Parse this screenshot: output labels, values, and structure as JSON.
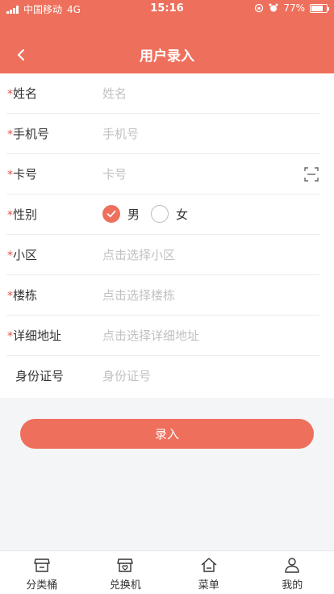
{
  "status_bar": {
    "carrier": "中国移动",
    "network": "4G",
    "time": "15:16",
    "battery": "77%",
    "battery_level": 0.77
  },
  "header": {
    "title": "用户录入",
    "back_icon": "chevron-left-icon"
  },
  "form": {
    "required_mark": "*",
    "name": {
      "label": "姓名",
      "placeholder": "姓名"
    },
    "phone": {
      "label": "手机号",
      "placeholder": "手机号"
    },
    "card": {
      "label": "卡号",
      "placeholder": "卡号",
      "icon": "scan-icon"
    },
    "gender": {
      "label": "性别",
      "options": [
        {
          "label": "男",
          "selected": true
        },
        {
          "label": "女",
          "selected": false
        }
      ]
    },
    "community": {
      "label": "小区",
      "placeholder": "点击选择小区"
    },
    "building": {
      "label": "楼栋",
      "placeholder": "点击选择楼栋"
    },
    "address": {
      "label": "详细地址",
      "placeholder": "点击选择详细地址"
    },
    "id_number": {
      "label": "身份证号",
      "placeholder": "身份证号"
    }
  },
  "submit_label": "录入",
  "tabbar": [
    {
      "label": "分类桶",
      "icon": "store-icon"
    },
    {
      "label": "兑换机",
      "icon": "exchange-machine-icon"
    },
    {
      "label": "菜单",
      "icon": "home-icon"
    },
    {
      "label": "我的",
      "icon": "user-icon"
    }
  ],
  "colors": {
    "accent": "#ee705c",
    "required": "#e0504a",
    "placeholder": "#c1c1c1",
    "background": "#f4f5f7"
  }
}
